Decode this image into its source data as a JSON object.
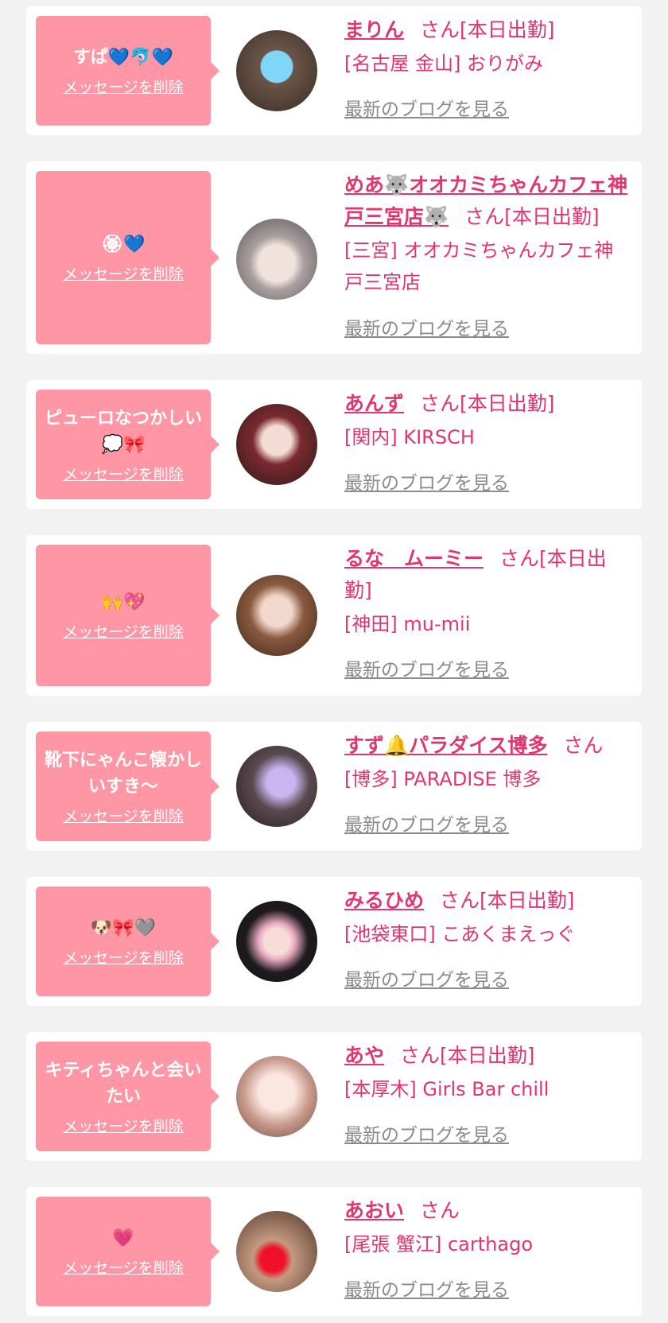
{
  "delete_label": "メッセージを削除",
  "blog_label": "最新のブログを見る",
  "colors": {
    "page_bg": "#f2f2f2",
    "bubble": "#fe96a6",
    "name": "#e0386e",
    "blog": "#8a8a8a"
  },
  "entries": [
    {
      "message": "すぱ💙🐬💙",
      "name": "まりん",
      "suffix": "さん[本日出勤]",
      "shop": "[名古屋 金山] おりがみ"
    },
    {
      "message": "🏵💙",
      "name": "めあ🐺オオカミちゃんカフェ神戸三宮店🐺",
      "suffix": "さん[本日出勤]",
      "shop": "[三宮] オオカミちゃんカフェ神戸三宮店"
    },
    {
      "message": "ピューロなつかしい💭🎀",
      "name": "あんず",
      "suffix": "さん[本日出勤]",
      "shop": "[関内] KIRSCH"
    },
    {
      "message": "🙌💖",
      "name": "るな　ムーミー",
      "suffix": "さん[本日出勤]",
      "shop": "[神田] mu-mii"
    },
    {
      "message": "靴下にゃんこ懐かしいすき〜",
      "name": "すず🔔パラダイス博多",
      "suffix": "さん",
      "shop": "[博多] PARADISE 博多"
    },
    {
      "message": "🐶🎀🩶",
      "name": "みるひめ",
      "suffix": "さん[本日出勤]",
      "shop": "[池袋東口] こあくまえっぐ"
    },
    {
      "message": "キティちゃんと会いたい",
      "name": "あや",
      "suffix": "さん[本日出勤]",
      "shop": "[本厚木] Girls Bar chill"
    },
    {
      "message": "💗",
      "name": "あおい",
      "suffix": "さん",
      "shop": "[尾張 蟹江] carthago"
    }
  ]
}
